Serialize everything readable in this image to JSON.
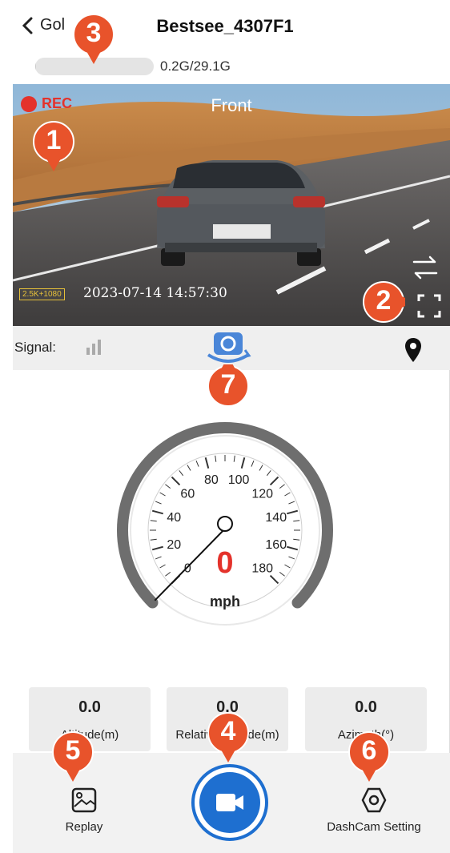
{
  "header": {
    "back_label": "Gol",
    "title": "Bestsee_4307F1",
    "storage_text": "0.2G/29.1G",
    "storage_used_fraction": 0.007
  },
  "video": {
    "rec_label": "REC",
    "camera_label": "Front",
    "resolution_badge": "2.5K+1080",
    "timestamp": "2023-07-14   14:57:30",
    "switch_icon": "switch-camera-icon",
    "fullscreen_icon": "fullscreen-icon"
  },
  "signal": {
    "label": "Signal:",
    "icon": "signal-bars-icon",
    "camera_switch_icon": "camera-rotate-icon",
    "location_icon": "location-pin-icon"
  },
  "speedometer": {
    "value": "0",
    "unit": "mph",
    "ticks": [
      "0",
      "20",
      "40",
      "60",
      "80",
      "100",
      "120",
      "140",
      "160",
      "180"
    ]
  },
  "stats": [
    {
      "value": "0.0",
      "label": "Altitude(m)"
    },
    {
      "value": "0.0",
      "label": "Relative altitude(m)"
    },
    {
      "value": "0.0",
      "label": "Azimuth(°)"
    }
  ],
  "bottom_nav": {
    "replay_label": "Replay",
    "settings_label": "DashCam Setting",
    "record_icon": "video-camera-icon"
  },
  "callouts": [
    "1",
    "2",
    "3",
    "4",
    "5",
    "6",
    "7"
  ],
  "colors": {
    "accent_blue": "#1e6fd0",
    "rec_red": "#e4322b",
    "callout_orange": "#e8532b"
  }
}
